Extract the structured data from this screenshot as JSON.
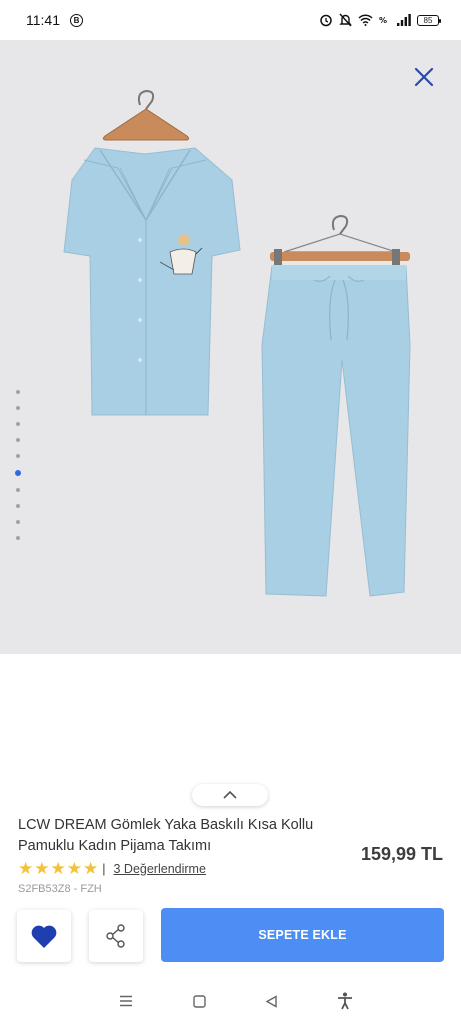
{
  "status_bar": {
    "time": "11:41",
    "notification_badge": "B",
    "battery_level": "85",
    "icons": [
      "alarm-icon",
      "mute-icon",
      "wifi-icon",
      "volte-icon",
      "signal-icon",
      "battery-icon"
    ]
  },
  "gallery": {
    "image_count": 10,
    "active_index": 5,
    "product_image": "blue-short-sleeve-pajama-set-on-hangers"
  },
  "product": {
    "title": "LCW DREAM Gömlek Yaka Baskılı Kısa Kollu Pamuklu Kadın Pijama Takımı",
    "price": "159,99 TL",
    "rating_stars": 5,
    "rating_separator": "|",
    "reviews_label": "3 Değerlendirme",
    "sku": "S2FB53Z8 - FZH"
  },
  "actions": {
    "add_to_cart_label": "SEPETE EKLE"
  },
  "colors": {
    "accent": "#4d8ef4",
    "heart": "#1f3fb0",
    "star": "#f2c23a",
    "image_bg": "#e7e7e9",
    "close_icon": "#2a4aa8"
  },
  "nav_bar": {
    "icons": [
      "menu-icon",
      "home-icon",
      "back-icon",
      "accessibility-icon"
    ]
  }
}
